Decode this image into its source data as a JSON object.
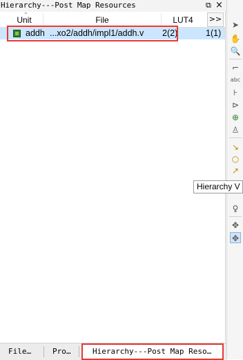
{
  "panel": {
    "title": "Hierarchy---Post Map Resources",
    "float_icon": "⧉",
    "close_icon": "×"
  },
  "table": {
    "columns": [
      "Unit",
      "File",
      "LUT4"
    ],
    "more_label": ">>",
    "rows": [
      {
        "unit": "addh",
        "file": "...xo2/addh/impl1/addh.v",
        "lut4": "2(2)",
        "extra": "1(1)"
      }
    ]
  },
  "tabs": [
    {
      "label": "File…"
    },
    {
      "label": "Pro…"
    },
    {
      "label": "Hierarchy---Post Map Reso…"
    }
  ],
  "tooltip": {
    "text": "Hierarchy V"
  },
  "colors": {
    "selection": "#cce6ff",
    "highlight_box": "#e53935"
  },
  "toolbar_icons": [
    "cursor-arrow",
    "hand",
    "magnifier",
    "wire",
    "abc-text",
    "pin",
    "tri-state",
    "add-green",
    "bus",
    "probe-a",
    "probe-b",
    "probe-c",
    "box",
    "lightbulb",
    "move-cross",
    "move-cross-selected"
  ]
}
